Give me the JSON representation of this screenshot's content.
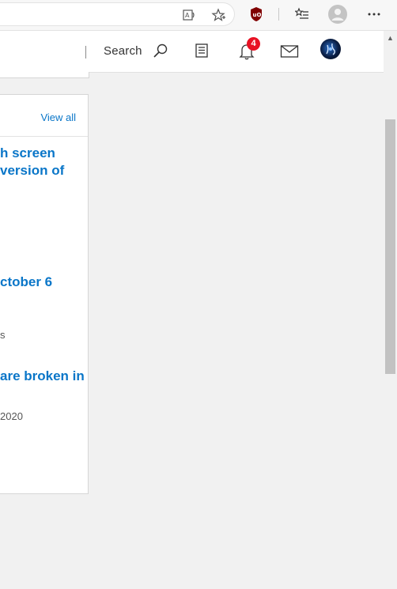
{
  "browser": {
    "icons": [
      "read-aloud-icon",
      "favorite-star-icon",
      "ublock-origin-icon",
      "favorites-list-icon",
      "profile-icon",
      "more-options-icon"
    ]
  },
  "header": {
    "search_label": "Search",
    "notification_count": "4",
    "icons": [
      "search-icon",
      "tasks-icon",
      "bell-icon",
      "mail-icon",
      "user-avatar"
    ]
  },
  "card": {
    "view_all": "View all",
    "items": [
      {
        "title_line1": "h screen",
        "title_line2": "version of",
        "meta": ""
      },
      {
        "title_line1": "ctober 6",
        "title_line2": "",
        "meta": "s"
      },
      {
        "title_line1": "are broken in",
        "title_line2": "",
        "meta": "2020"
      }
    ]
  },
  "colors": {
    "link_blue": "#0a76c8",
    "badge_red": "#e81123",
    "page_bg": "#f1f1f1"
  }
}
